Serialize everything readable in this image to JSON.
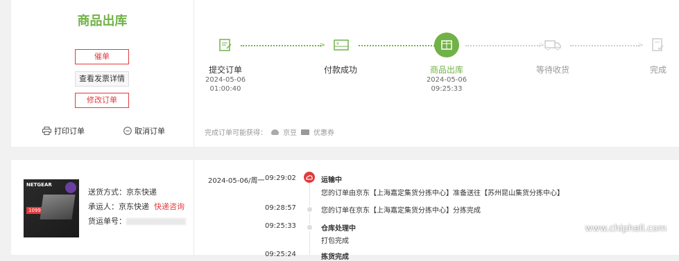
{
  "order_status": {
    "title": "商品出库",
    "btn_urge": "催单",
    "btn_invoice": "查看发票详情",
    "btn_modify": "修改订单",
    "print_label": "打印订单",
    "cancel_label": "取消订单"
  },
  "steps": [
    {
      "label": "提交订单",
      "date": "2024-05-06",
      "time": "01:00:40",
      "state": "done"
    },
    {
      "label": "付款成功",
      "date": "",
      "time": "",
      "state": "done"
    },
    {
      "label": "商品出库",
      "date": "2024-05-06",
      "time": "09:25:33",
      "state": "current"
    },
    {
      "label": "等待收货",
      "date": "",
      "time": "",
      "state": "pending"
    },
    {
      "label": "完成",
      "date": "",
      "time": "",
      "state": "pending"
    }
  ],
  "rewards": {
    "prefix": "完成订单可能获得：",
    "bean": "京豆",
    "coupon": "优惠券"
  },
  "product": {
    "brand": "NETGEAR",
    "price_tag": "1099"
  },
  "shipping": {
    "method_label": "送货方式：京东快递",
    "carrier_label": "承运人：京东快递",
    "carrier_link": "快递咨询",
    "tracking_label": "货运单号："
  },
  "timeline": {
    "date": "2024-05-06/周一",
    "entries": [
      {
        "time": "09:29:02",
        "title": "运输中",
        "text": "您的订单由京东【上海嘉定集货分拣中心】准备送往【苏州昆山集货分拣中心】"
      },
      {
        "time": "09:28:57",
        "title": "",
        "text": "您的订单在京东【上海嘉定集货分拣中心】分拣完成"
      },
      {
        "time": "09:25:33",
        "title": "仓库处理中",
        "text": "打包完成"
      },
      {
        "time": "09:25:24",
        "title": "拣货完成",
        "text": ""
      }
    ]
  },
  "watermark": "www.chiphell.com",
  "colors": {
    "green": "#71b247",
    "red": "#e4393c",
    "gray": "#cccccc"
  }
}
